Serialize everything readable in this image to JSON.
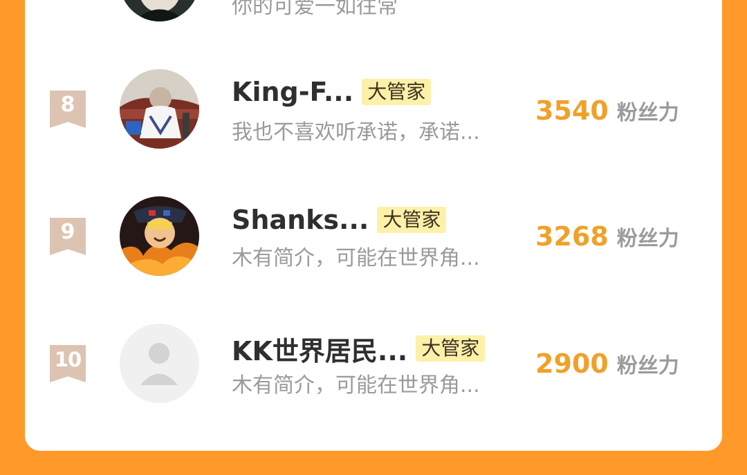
{
  "top_row": {
    "bio": "你的可爱一如往常"
  },
  "rows": [
    {
      "rank": "8",
      "name": "King-F...",
      "badge": "大管家",
      "bio": "我也不喜欢听承诺，承诺...",
      "score": "3540",
      "score_unit": "粉丝力"
    },
    {
      "rank": "9",
      "name": "Shanks...",
      "badge": "大管家",
      "bio": "木有简介，可能在世界角...",
      "score": "3268",
      "score_unit": "粉丝力"
    },
    {
      "rank": "10",
      "name": "KK世界居民...",
      "badge": "大管家",
      "bio": "木有简介，可能在世界角...",
      "score": "2900",
      "score_unit": "粉丝力"
    }
  ],
  "colors": {
    "page_background": "#ff9a2a",
    "panel_background": "#ffffff",
    "rank_badge": "#ddc3b2",
    "score": "#f0a12a",
    "score_unit": "#9b9b9b",
    "name": "#2f2f2f",
    "bio": "#9a9a9a",
    "badge_background": "#fdf0a9"
  },
  "icons": {
    "rank_badge": "ribbon-bookmark-icon",
    "default_avatar": "user-placeholder-icon"
  }
}
